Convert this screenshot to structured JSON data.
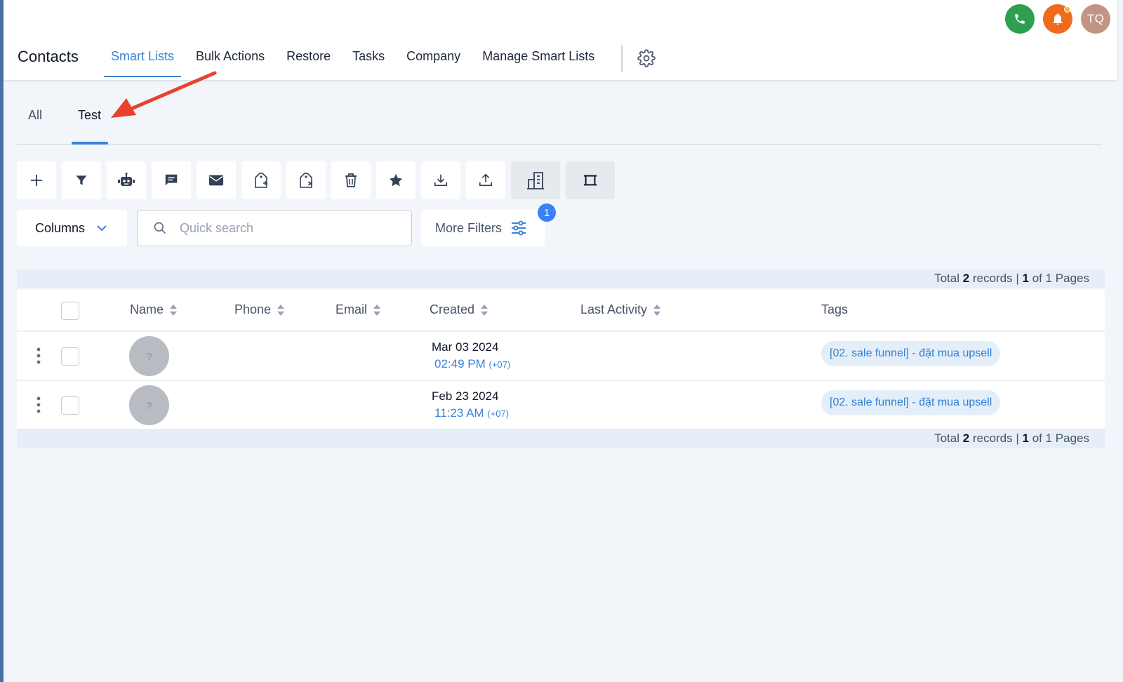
{
  "header": {
    "title": "Contacts",
    "avatar_initials": "TQ",
    "nav": [
      {
        "label": "Smart Lists",
        "active": true
      },
      {
        "label": "Bulk Actions"
      },
      {
        "label": "Restore"
      },
      {
        "label": "Tasks"
      },
      {
        "label": "Company"
      },
      {
        "label": "Manage Smart Lists"
      }
    ]
  },
  "subtabs": [
    {
      "label": "All"
    },
    {
      "label": "Test",
      "active": true
    }
  ],
  "toolbar": {
    "icons": [
      "add-icon",
      "filter-icon",
      "robot-icon",
      "message-icon",
      "email-icon",
      "add-tag-icon",
      "remove-tag-icon",
      "delete-icon",
      "star-icon",
      "import-icon",
      "export-icon",
      "company-icon",
      "crop-icon"
    ]
  },
  "filters": {
    "columns_label": "Columns",
    "search_placeholder": "Quick search",
    "more_filters_label": "More Filters",
    "more_filters_count": "1"
  },
  "records": {
    "prefix": "Total",
    "count": "2",
    "records_word": "records |",
    "page": "1",
    "of_pages": "of 1 Pages"
  },
  "table": {
    "columns": [
      "Name",
      "Phone",
      "Email",
      "Created",
      "Last Activity",
      "Tags"
    ],
    "rows": [
      {
        "avatar": "?",
        "date": "Mar 03 2024",
        "time": "02:49 PM",
        "tz": "(+07)",
        "tag": "[02. sale funnel] - đặt mua upsell"
      },
      {
        "avatar": "?",
        "date": "Feb 23 2024",
        "time": "11:23 AM",
        "tz": "(+07)",
        "tag": "[02. sale funnel] - đặt mua upsell"
      }
    ]
  },
  "colors": {
    "accent": "#3b82d6",
    "phone": "#2e9e4f",
    "bell": "#f06a1c",
    "avatar": "#c29484",
    "annotation_arrow": "#e8412c"
  }
}
